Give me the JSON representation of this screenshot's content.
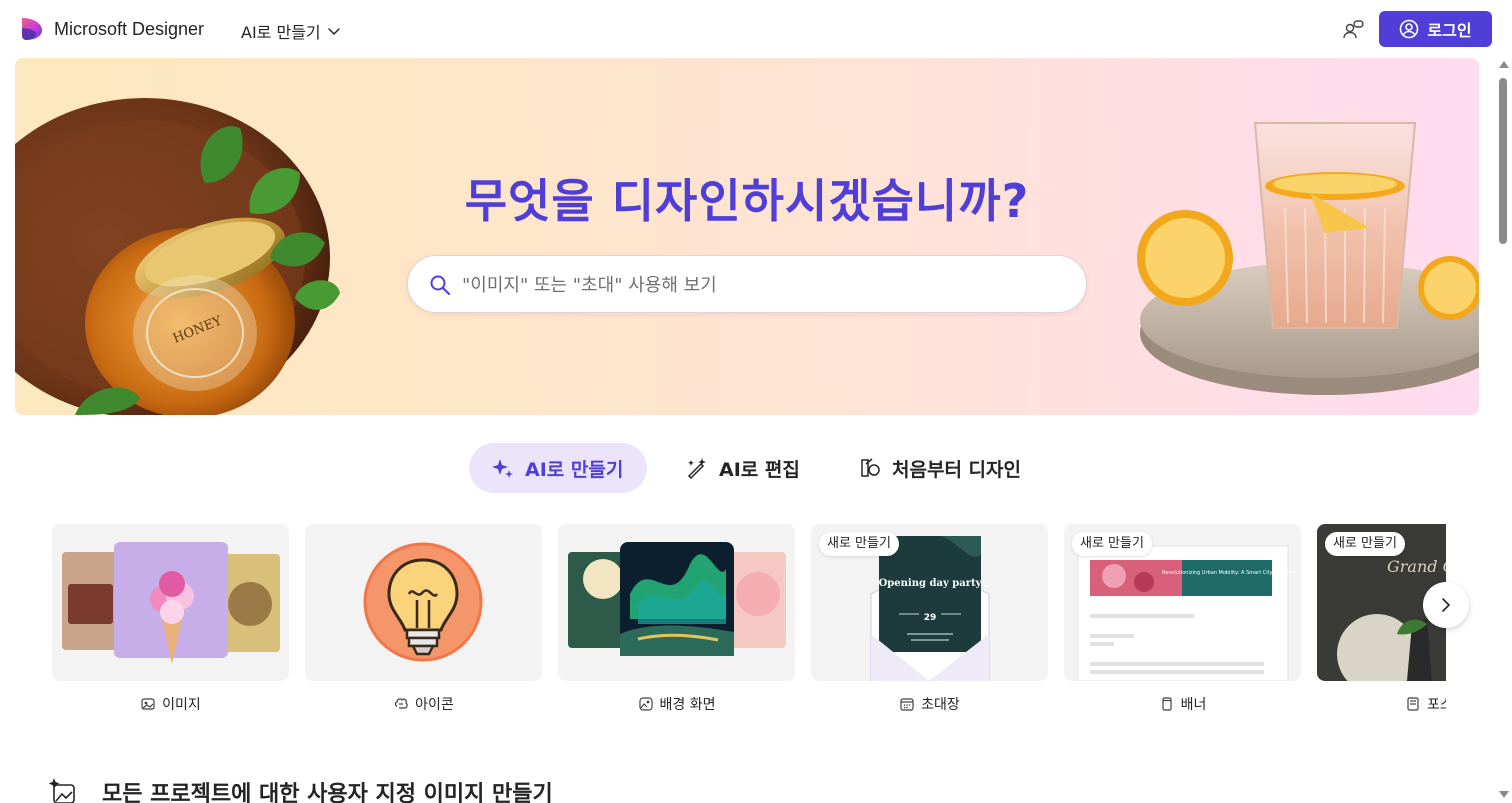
{
  "header": {
    "brand": "Microsoft Designer",
    "mode_menu": "AI로 만들기",
    "login_label": "로그인"
  },
  "hero": {
    "title": "무엇을 디자인하시겠습니까?",
    "search_placeholder": "\"이미지\" 또는 \"초대\" 사용해 보기",
    "honey_label": "HONEY"
  },
  "tabs": [
    {
      "label": "AI로 만들기",
      "icon": "sparkle-icon",
      "active": true
    },
    {
      "label": "AI로 편집",
      "icon": "magic-wand-icon",
      "active": false
    },
    {
      "label": "처음부터 디자인",
      "icon": "brush-icon",
      "active": false
    }
  ],
  "cards": [
    {
      "label": "이미지",
      "icon": "image-icon",
      "badge": ""
    },
    {
      "label": "아이콘",
      "icon": "icon-shape-icon",
      "badge": ""
    },
    {
      "label": "배경 화면",
      "icon": "wallpaper-icon",
      "badge": ""
    },
    {
      "label": "초대장",
      "icon": "calendar-icon",
      "badge": "새로 만들기",
      "thumb_text": "Opening day party",
      "thumb_date": "29"
    },
    {
      "label": "배너",
      "icon": "banner-icon",
      "badge": "새로 만들기",
      "thumb_text": "Revolutionizing Urban Mobility: A Smart City Initiative"
    },
    {
      "label": "포스터",
      "icon": "poster-icon",
      "badge": "새로 만들기",
      "thumb_text": "Grand Open"
    }
  ],
  "section": {
    "title": "모든 프로젝트에 대한 사용자 지정 이미지 만들기"
  },
  "colors": {
    "accent": "#4f3fd8",
    "tab_active_bg": "#ebe4fb",
    "hero_gradient_start": "#fde8bf",
    "hero_gradient_end": "#ffdcee"
  }
}
